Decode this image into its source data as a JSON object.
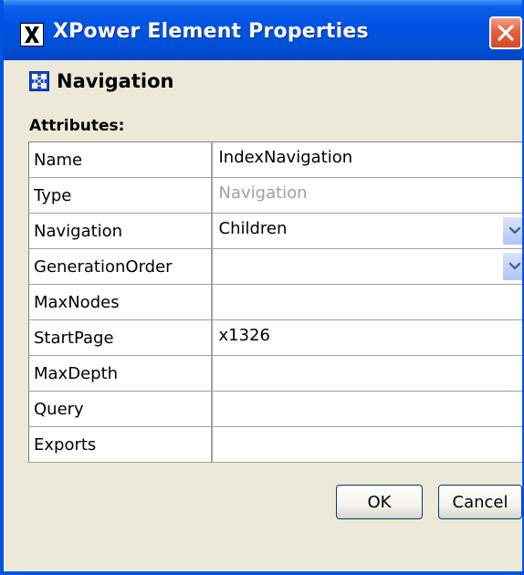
{
  "window": {
    "title": "XPower Element Properties",
    "title_icon": "x-logo-icon",
    "close_icon": "close-icon"
  },
  "section": {
    "icon": "navigation-icon",
    "title": "Navigation"
  },
  "attributes": {
    "label": "Attributes:",
    "rows": [
      {
        "key": "Name",
        "value": "IndexNavigation",
        "editable": true,
        "combo": false
      },
      {
        "key": "Type",
        "value": "Navigation",
        "editable": false,
        "combo": false
      },
      {
        "key": "Navigation",
        "value": "Children",
        "editable": true,
        "combo": true
      },
      {
        "key": "GenerationOrder",
        "value": "",
        "editable": true,
        "combo": true
      },
      {
        "key": "MaxNodes",
        "value": "",
        "editable": true,
        "combo": false
      },
      {
        "key": "StartPage",
        "value": "x1326",
        "editable": true,
        "combo": false
      },
      {
        "key": "MaxDepth",
        "value": "",
        "editable": true,
        "combo": false
      },
      {
        "key": "Query",
        "value": "",
        "editable": true,
        "combo": false
      },
      {
        "key": "Exports",
        "value": "",
        "editable": true,
        "combo": false
      }
    ]
  },
  "buttons": {
    "ok_label": "OK",
    "cancel_label": "Cancel"
  },
  "colors": {
    "titlebar": "#0054e3",
    "window_bg": "#ece9d8",
    "close_button": "#d24a22",
    "disabled_text": "#a0a0a0",
    "combo_arrow": "#4d6185"
  }
}
